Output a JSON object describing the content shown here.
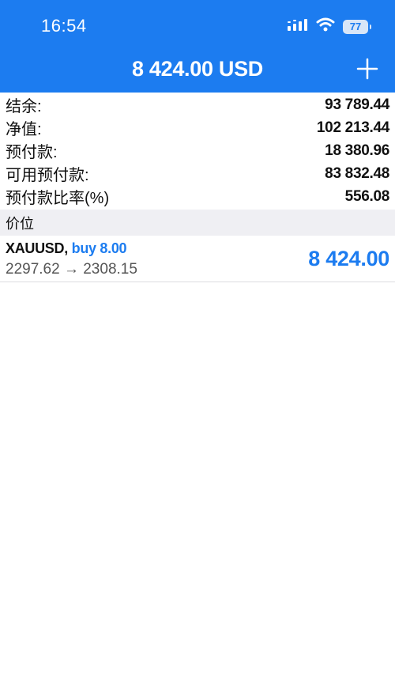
{
  "status_bar": {
    "time": "16:54",
    "battery": "77",
    "icons": [
      "cellular-signal-icon",
      "wifi-icon",
      "battery-icon"
    ]
  },
  "header": {
    "title": "8 424.00 USD",
    "action": "plus-icon"
  },
  "summary": [
    {
      "label": "结余:",
      "value": "93 789.44"
    },
    {
      "label": "净值:",
      "value": "102 213.44"
    },
    {
      "label": "预付款:",
      "value": "18 380.96"
    },
    {
      "label": "可用预付款:",
      "value": "83 832.48"
    },
    {
      "label": "预付款比率(%)",
      "value": "556.08"
    }
  ],
  "positions_section": {
    "title": "价位"
  },
  "positions": [
    {
      "symbol": "XAUUSD,",
      "side": "buy 8.00",
      "prices": "2297.62 → 2308.15",
      "profit": "8 424.00"
    }
  ],
  "colors": {
    "accent": "#1c7cf0",
    "section_bg": "#efeff3",
    "text": "#111111",
    "muted": "#555555"
  }
}
